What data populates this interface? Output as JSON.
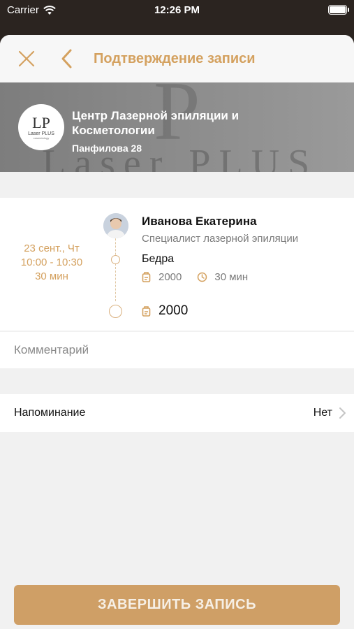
{
  "status_bar": {
    "carrier": "Carrier",
    "time": "12:26 PM"
  },
  "nav": {
    "title": "Подтверждение записи"
  },
  "organization": {
    "name": "Центр Лазерной эпиляции и Косметологии",
    "address": "Панфилова 28",
    "logo_monogram": "LP",
    "logo_brand": "Laser PLUS",
    "logo_sub": "cosmetology"
  },
  "appointment": {
    "date": "23 сент., Чт",
    "time_range": "10:00 - 10:30",
    "duration": "30 мин",
    "employee": {
      "name": "Иванова Екатерина",
      "role": "Специалист лазерной эпиляции"
    },
    "service": {
      "name": "Бедра",
      "price": "2000",
      "duration": "30 мин"
    },
    "total": "2000"
  },
  "comment": {
    "placeholder": "Комментарий",
    "value": ""
  },
  "reminder": {
    "label": "Напоминание",
    "value": "Нет"
  },
  "submit": {
    "label": "ЗАВЕРШИТЬ ЗАПИСЬ"
  },
  "colors": {
    "accent": "#d4a15f",
    "button": "#cf9f66",
    "background": "#f1f1f1"
  },
  "icons": [
    "wifi-icon",
    "battery-icon",
    "close-icon",
    "back-arrow-icon",
    "price-tag-icon",
    "clock-icon",
    "chevron-right-icon"
  ]
}
